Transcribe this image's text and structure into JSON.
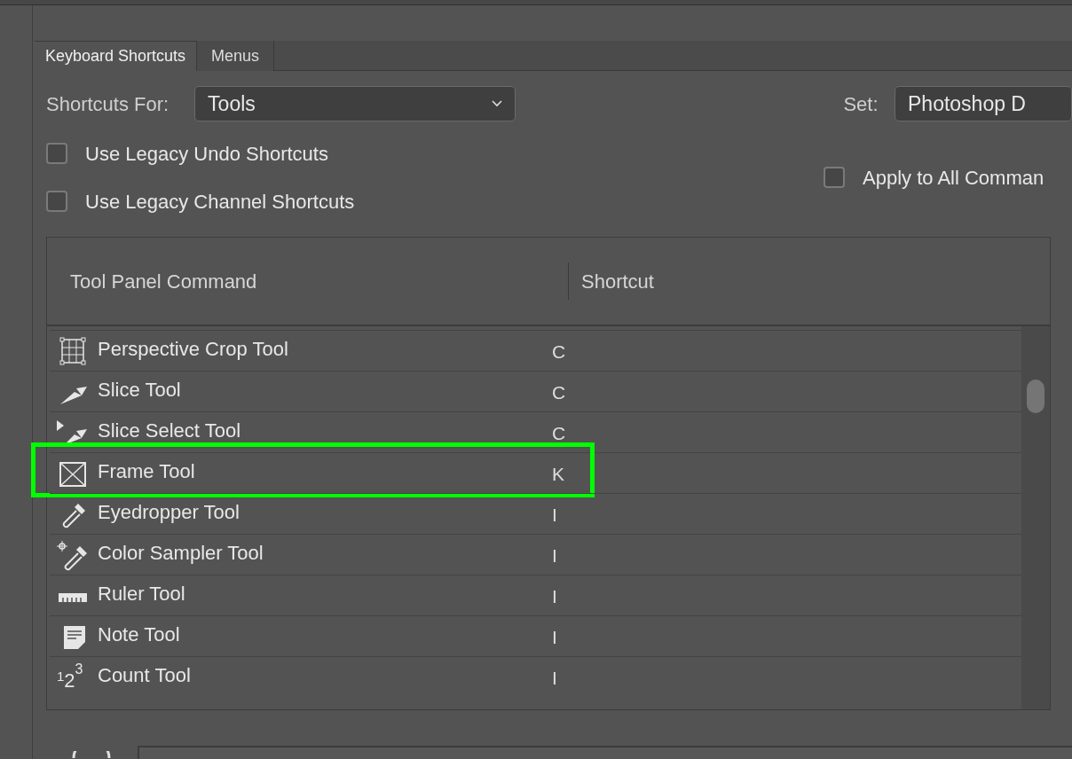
{
  "tabs": [
    {
      "label": "Keyboard Shortcuts",
      "selected": true
    },
    {
      "label": "Menus",
      "selected": false
    }
  ],
  "shortcuts_for": {
    "label": "Shortcuts For:",
    "value": "Tools"
  },
  "set": {
    "label": "Set:",
    "value": "Photoshop D"
  },
  "options": [
    {
      "label": "Use Legacy Undo Shortcuts",
      "checked": false
    },
    {
      "label": "Use Legacy Channel Shortcuts",
      "checked": false
    }
  ],
  "apply_all": {
    "label": "Apply to All Comman",
    "checked": false
  },
  "table": {
    "columns": [
      "Tool Panel Command",
      "Shortcut"
    ],
    "rows": [
      {
        "name": "Perspective Crop Tool",
        "shortcut": "C",
        "highlighted": false
      },
      {
        "name": "Slice Tool",
        "shortcut": "C",
        "highlighted": false
      },
      {
        "name": "Slice Select Tool",
        "shortcut": "C",
        "highlighted": false
      },
      {
        "name": "Frame Tool",
        "shortcut": "K",
        "highlighted": true
      },
      {
        "name": "Eyedropper Tool",
        "shortcut": "I",
        "highlighted": false
      },
      {
        "name": "Color Sampler Tool",
        "shortcut": "I",
        "highlighted": false
      },
      {
        "name": "Ruler Tool",
        "shortcut": "I",
        "highlighted": false
      },
      {
        "name": "Note Tool",
        "shortcut": "I",
        "highlighted": false
      },
      {
        "name": "Count Tool",
        "shortcut": "I",
        "highlighted": false,
        "icon_digits": [
          "1",
          "2",
          "3"
        ]
      }
    ]
  }
}
